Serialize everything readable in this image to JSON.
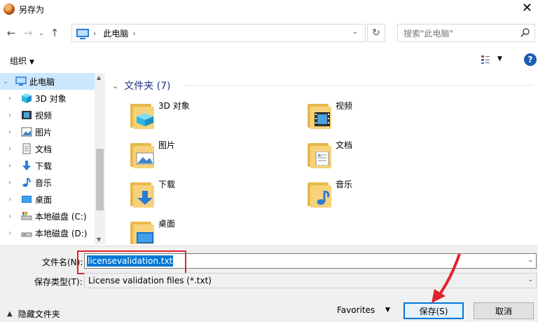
{
  "window": {
    "title": "另存为",
    "close_glyph": "✕"
  },
  "nav": {
    "back_glyph": "←",
    "forward_glyph": "→",
    "recent_glyph": "⌄",
    "up_glyph": "↑",
    "crumb_sep": "›",
    "location": "此电脑",
    "crumb_end": "›",
    "drop_glyph": "⌄",
    "refresh_glyph": "↻",
    "search_placeholder": "搜索\"此电脑\""
  },
  "toolbar": {
    "organize": "组织",
    "organize_caret": "▼",
    "view_caret": "▼",
    "help": "?"
  },
  "sidebar": {
    "items": [
      {
        "label": "此电脑",
        "icon": "pc-icon",
        "expander": "⌄",
        "selected": true
      },
      {
        "label": "3D 对象",
        "icon": "cube-icon",
        "expander": "›"
      },
      {
        "label": "视频",
        "icon": "video-icon",
        "expander": "›"
      },
      {
        "label": "图片",
        "icon": "picture-icon",
        "expander": "›"
      },
      {
        "label": "文档",
        "icon": "document-icon",
        "expander": "›"
      },
      {
        "label": "下载",
        "icon": "download-icon",
        "expander": "›"
      },
      {
        "label": "音乐",
        "icon": "music-icon",
        "expander": "›"
      },
      {
        "label": "桌面",
        "icon": "desktop-icon",
        "expander": "›"
      },
      {
        "label": "本地磁盘 (C:)",
        "icon": "drive-c-icon",
        "expander": "›"
      },
      {
        "label": "本地磁盘 (D:)",
        "icon": "drive-icon",
        "expander": "›"
      }
    ],
    "scroll_up": "▲",
    "scroll_down": "▼"
  },
  "main": {
    "group_caret": "⌄",
    "group_title": "文件夹 (7)",
    "folders": [
      {
        "label": "3D 对象",
        "icon": "cube-icon"
      },
      {
        "label": "视频",
        "icon": "video-icon"
      },
      {
        "label": "图片",
        "icon": "picture-icon"
      },
      {
        "label": "文档",
        "icon": "document-icon"
      },
      {
        "label": "下载",
        "icon": "download-icon"
      },
      {
        "label": "音乐",
        "icon": "music-icon"
      },
      {
        "label": "桌面",
        "icon": "desktop-icon"
      }
    ]
  },
  "bottom": {
    "filename_label": "文件名(N):",
    "filename_value": "licensevalidation.txt",
    "filetype_label": "保存类型(T):",
    "filetype_value": "License validation files (*.txt)",
    "drop_glyph": "⌄",
    "hide_folders_caret": "▲",
    "hide_folders": "隐藏文件夹",
    "favorites": "Favorites",
    "favorites_caret": "▼",
    "save": "保存(S)",
    "cancel": "取消"
  },
  "colors": {
    "accent": "#0078d7",
    "highlight": "#e0232f",
    "folder": "#f7d27b",
    "link": "#1e3287"
  }
}
